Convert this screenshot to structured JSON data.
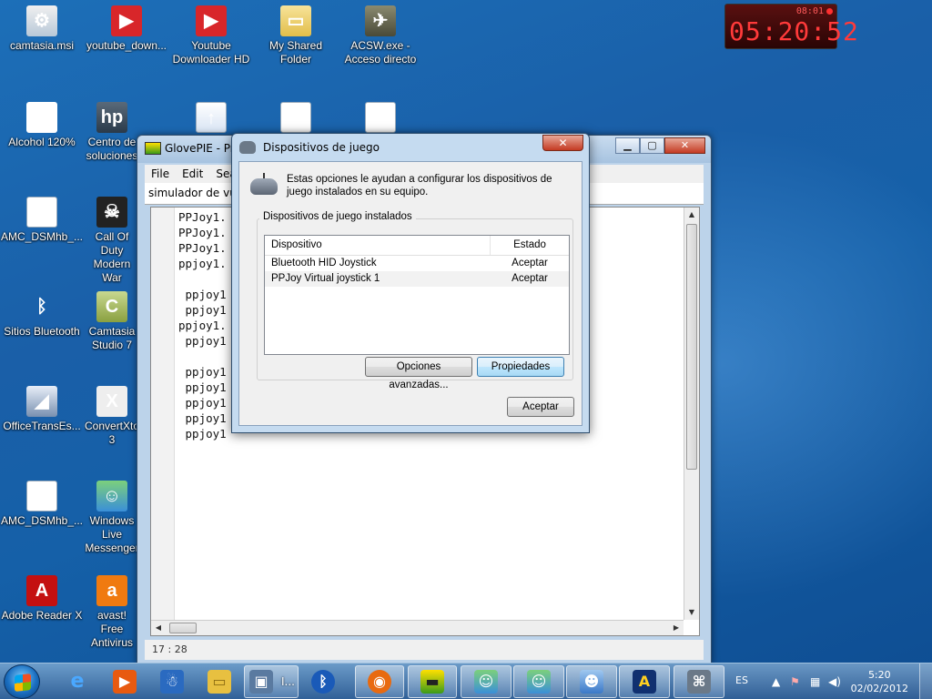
{
  "desktop": {
    "icons": [
      {
        "label": "camtasia.msi",
        "icon": "installer-icon",
        "glyph": "⚙"
      },
      {
        "label": "youtube_down...",
        "icon": "video-icon",
        "glyph": "▶"
      },
      {
        "label": "Youtube Downloader HD",
        "icon": "video-icon",
        "glyph": "▶"
      },
      {
        "label": "My Shared Folder",
        "icon": "folder-icon",
        "glyph": "▭"
      },
      {
        "label": "ACSW.exe - Acceso directo",
        "icon": "game-icon",
        "glyph": "✈"
      },
      {
        "label": "Alcohol 120%",
        "icon": "alcohol-icon",
        "glyph": "A"
      },
      {
        "label": "Centro de soluciones",
        "icon": "hp-icon",
        "glyph": "hp"
      },
      {
        "label": "",
        "icon": "update-icon",
        "glyph": "↑"
      },
      {
        "label": "",
        "icon": "document-icon",
        "glyph": "≡"
      },
      {
        "label": "",
        "icon": "word-icon",
        "glyph": "W"
      },
      {
        "label": "AMC_DSMhb_...",
        "icon": "word-icon",
        "glyph": "W"
      },
      {
        "label": "Call Of Duty Modern War",
        "icon": "game-icon",
        "glyph": "☠"
      },
      {
        "label": "Sitios Bluetooth",
        "icon": "bluetooth-icon",
        "glyph": "ᛒ"
      },
      {
        "label": "Camtasia Studio 7",
        "icon": "camtasia-icon",
        "glyph": "C"
      },
      {
        "label": "OfficeTransEs...",
        "icon": "office-icon",
        "glyph": "◢"
      },
      {
        "label": "ConvertXtoDVD 3",
        "icon": "convert-icon",
        "glyph": "X"
      },
      {
        "label": "AMC_DSMhb_...",
        "icon": "word-icon",
        "glyph": "W"
      },
      {
        "label": "Windows Live Messenger",
        "icon": "messenger-icon",
        "glyph": "☺"
      },
      {
        "label": "Adobe Reader X",
        "icon": "pdf-icon",
        "glyph": "A"
      },
      {
        "label": "avast! Free Antivirus",
        "icon": "avast-icon",
        "glyph": "a"
      }
    ]
  },
  "clock_widget": {
    "small": "08:01",
    "big": "05:20:52"
  },
  "glovepie": {
    "title": "GlovePIE - Pro",
    "menu": [
      "File",
      "Edit",
      "Sear"
    ],
    "tab": "simulador de vuelo",
    "code": "PPJoy1.\nPPJoy1.\nPPJoy1.\nppjoy1.\n\n ppjoy1\n ppjoy1\nppjoy1.\n ppjoy1\n\n ppjoy1\n ppjoy1\n ppjoy1\n ppjoy1\n ppjoy1",
    "status": "17 : 28"
  },
  "dialog": {
    "title": "Dispositivos de juego",
    "close": "✕",
    "intro": "Estas opciones le ayudan a configurar los dispositivos de juego instalados en su equipo.",
    "group_label": "Dispositivos de juego instalados",
    "columns": {
      "device": "Dispositivo",
      "status": "Estado"
    },
    "rows": [
      {
        "device": "Bluetooth HID Joystick",
        "status": "Aceptar"
      },
      {
        "device": "PPJoy Virtual joystick 1",
        "status": "Aceptar"
      }
    ],
    "buttons": {
      "advanced": "Opciones avanzadas...",
      "properties": "Propiedades",
      "ok": "Aceptar"
    }
  },
  "taskbar": {
    "items": [
      {
        "name": "ie-icon",
        "glyph": "e"
      },
      {
        "name": "media-icon",
        "glyph": "▶"
      },
      {
        "name": "snowman-icon",
        "glyph": "☃"
      },
      {
        "name": "explorer-icon",
        "glyph": "▭"
      },
      {
        "name": "computer-icon",
        "glyph": "▣",
        "label": "I..."
      },
      {
        "name": "bluetooth-icon",
        "glyph": "ᛒ"
      },
      {
        "name": "firefox-icon",
        "glyph": "◉"
      },
      {
        "name": "glovepie-icon",
        "glyph": "▬"
      },
      {
        "name": "messenger-icon",
        "glyph": "☺"
      },
      {
        "name": "messenger-icon",
        "glyph": "☺"
      },
      {
        "name": "chat-icon",
        "glyph": "☻"
      },
      {
        "name": "arrow-app-icon",
        "glyph": "A"
      },
      {
        "name": "gamepad-icon",
        "glyph": "⌘"
      }
    ],
    "lang": "ES",
    "time": "5:20",
    "date": "02/02/2012"
  }
}
